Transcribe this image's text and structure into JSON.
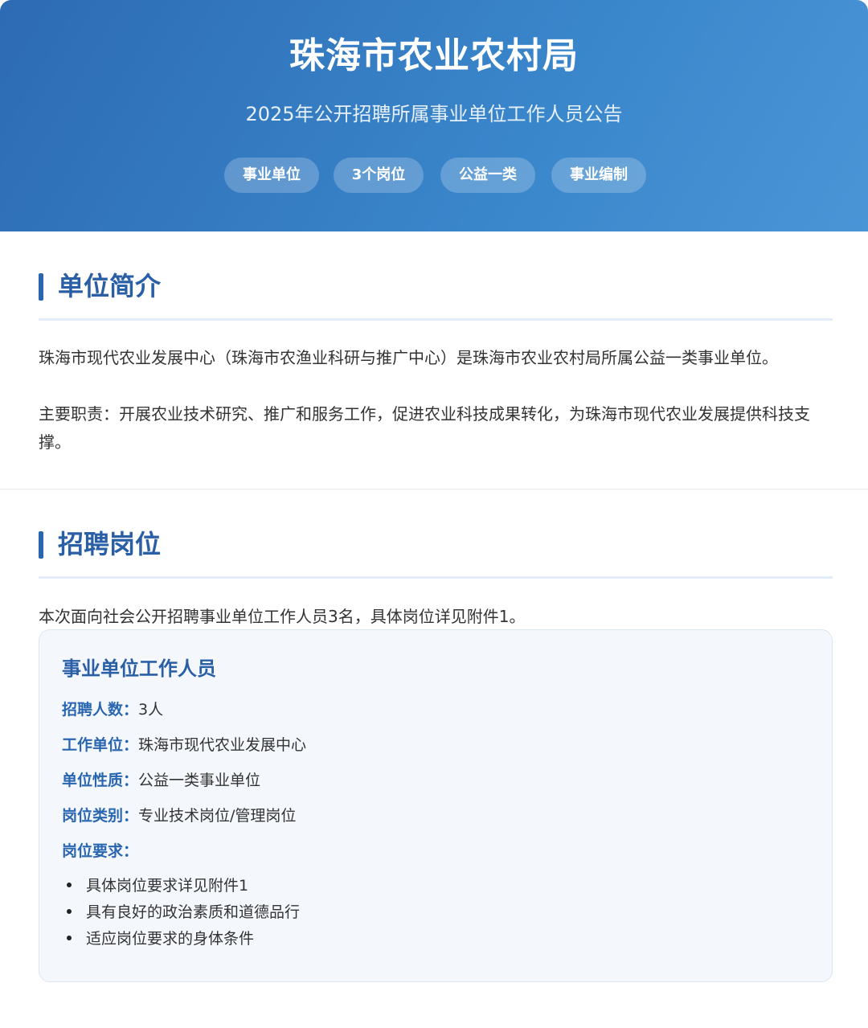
{
  "header": {
    "title": "珠海市农业农村局",
    "subtitle": "2025年公开招聘所属事业单位工作人员公告",
    "tags": [
      "事业单位",
      "3个岗位",
      "公益一类",
      "事业编制"
    ]
  },
  "intro": {
    "heading": "单位简介",
    "paragraph1": "珠海市现代农业发展中心（珠海市农渔业科研与推广中心）是珠海市农业农村局所属公益一类事业单位。",
    "paragraph2": "主要职责：开展农业技术研究、推广和服务工作，促进农业科技成果转化，为珠海市现代农业发展提供科技支撑。"
  },
  "positions": {
    "heading": "招聘岗位",
    "summary": "本次面向社会公开招聘事业单位工作人员3名，具体岗位详见附件1。",
    "card": {
      "title": "事业单位工作人员",
      "rows": [
        {
          "label": "招聘人数：",
          "value": "3人"
        },
        {
          "label": "工作单位：",
          "value": "珠海市现代农业发展中心"
        },
        {
          "label": "单位性质：",
          "value": "公益一类事业单位"
        },
        {
          "label": "岗位类别：",
          "value": "专业技术岗位/管理岗位"
        },
        {
          "label": "岗位要求：",
          "value": ""
        }
      ],
      "requirements": [
        "具体岗位要求详见附件1",
        "具有良好的政治素质和道德品行",
        "适应岗位要求的身体条件"
      ]
    }
  }
}
